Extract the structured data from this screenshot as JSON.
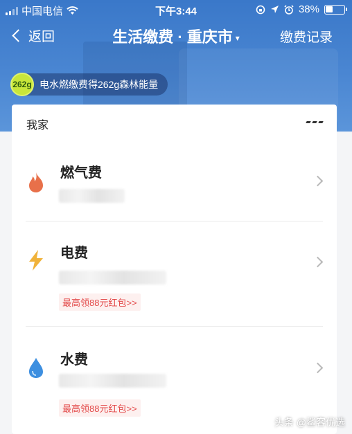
{
  "status_bar": {
    "carrier": "中国电信",
    "time": "下午3:44",
    "battery": "38%",
    "battery_level": 0.38
  },
  "nav": {
    "back_label": "返回",
    "title": "生活缴费 · 重庆市",
    "title_caret": "▾",
    "record_label": "缴费记录"
  },
  "energy": {
    "badge": "262g",
    "text": "电水燃缴费得262g森林能量"
  },
  "card": {
    "title": "我家",
    "items": [
      {
        "name": "燃气费",
        "icon": "flame-icon",
        "color": "#e8704a",
        "promo": ""
      },
      {
        "name": "电费",
        "icon": "lightning-icon",
        "color": "#f0b23a",
        "promo": "最高领88元红包>>"
      },
      {
        "name": "水费",
        "icon": "water-drop-icon",
        "color": "#3d8fe0",
        "promo": "最高领88元红包>>"
      }
    ]
  },
  "watermark": "头条 @鲨客优选",
  "colors": {
    "header_blue": "#4a86d2",
    "promo_red": "#e34a4a",
    "energy_green": "#c8e63a"
  }
}
